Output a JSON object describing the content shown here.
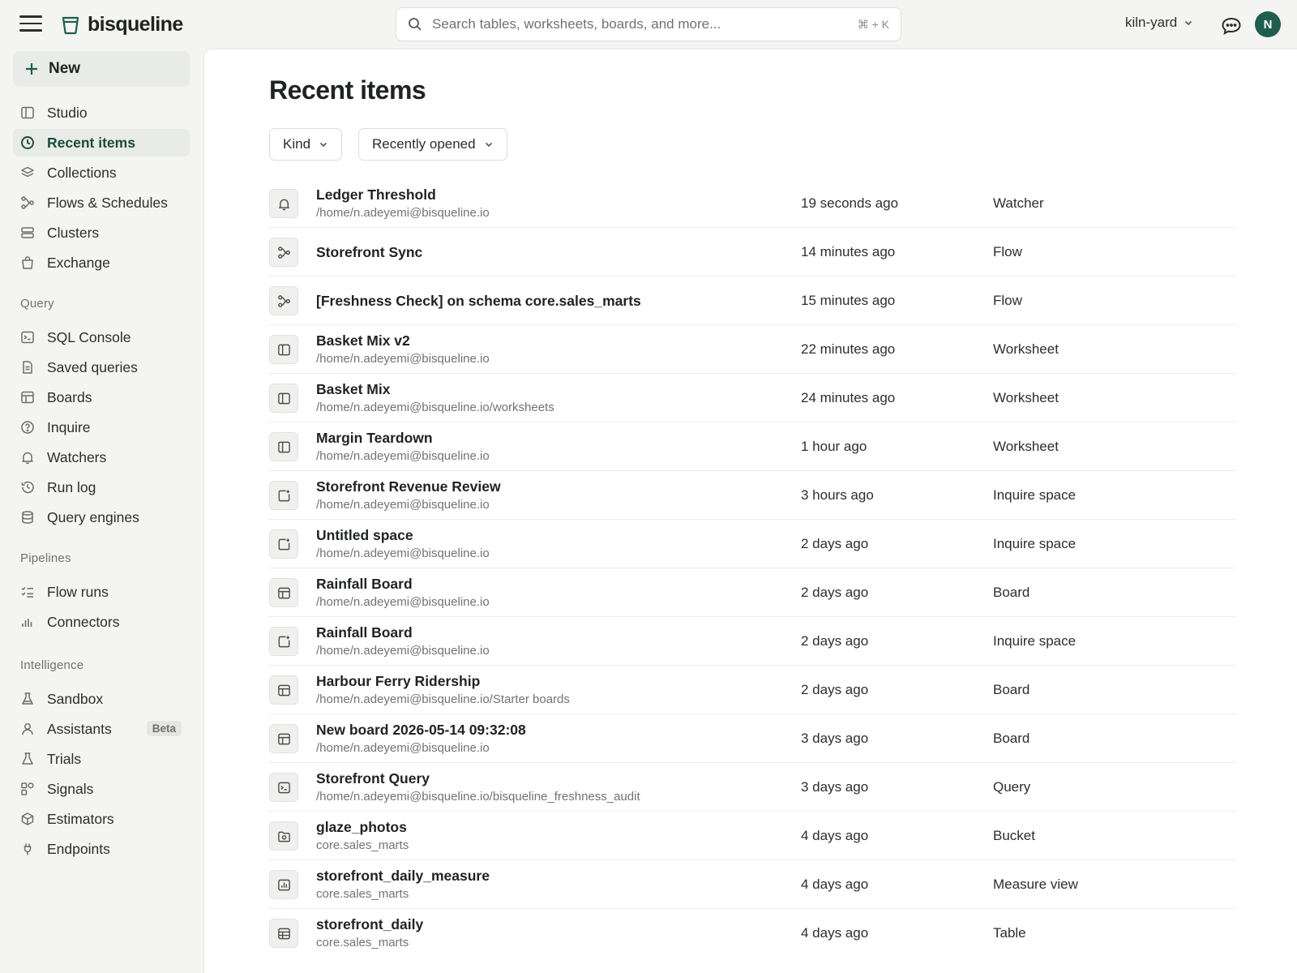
{
  "app": {
    "name": "bisqueline",
    "logo_icon": "bucket-logo-icon"
  },
  "search": {
    "placeholder": "Search tables, worksheets, boards, and more...",
    "shortcut": "⌘ + K"
  },
  "workspace": {
    "name": "kiln-yard"
  },
  "user": {
    "initial": "N",
    "avatar_color": "#1f5e4e"
  },
  "sidebar": {
    "new_label": "New",
    "main_items": [
      {
        "label": "Studio",
        "icon": "panel-icon"
      },
      {
        "label": "Recent items",
        "icon": "clock-icon",
        "active": true
      },
      {
        "label": "Collections",
        "icon": "layers-icon"
      },
      {
        "label": "Flows & Schedules",
        "icon": "flow-icon"
      },
      {
        "label": "Clusters",
        "icon": "server-icon"
      },
      {
        "label": "Exchange",
        "icon": "bag-icon"
      }
    ],
    "query_section": "Query",
    "query_items": [
      {
        "label": "SQL Console",
        "icon": "terminal-icon"
      },
      {
        "label": "Saved queries",
        "icon": "file-icon"
      },
      {
        "label": "Boards",
        "icon": "board-icon"
      },
      {
        "label": "Inquire",
        "icon": "question-icon"
      },
      {
        "label": "Watchers",
        "icon": "bell-icon"
      },
      {
        "label": "Run log",
        "icon": "history-icon"
      },
      {
        "label": "Query engines",
        "icon": "database-icon"
      }
    ],
    "pipelines_section": "Pipelines",
    "pipelines_items": [
      {
        "label": "Flow runs",
        "icon": "checklist-icon"
      },
      {
        "label": "Connectors",
        "icon": "bars-icon"
      }
    ],
    "intelligence_section": "Intelligence",
    "intelligence_items": [
      {
        "label": "Sandbox",
        "icon": "flask-icon"
      },
      {
        "label": "Assistants",
        "icon": "person-icon",
        "badge": "Beta"
      },
      {
        "label": "Trials",
        "icon": "beaker-icon"
      },
      {
        "label": "Signals",
        "icon": "shapes-icon"
      },
      {
        "label": "Estimators",
        "icon": "cube-icon"
      },
      {
        "label": "Endpoints",
        "icon": "plug-icon"
      }
    ]
  },
  "main": {
    "title": "Recent items",
    "filters": {
      "kind": "Kind",
      "sort": "Recently opened"
    },
    "items": [
      {
        "name": "Ledger Threshold",
        "path": "/home/n.adeyemi@bisqueline.io",
        "time": "19 seconds ago",
        "kind": "Watcher",
        "icon": "bell-icon"
      },
      {
        "name": "Storefront Sync",
        "path": "",
        "time": "14 minutes ago",
        "kind": "Flow",
        "icon": "flow-icon"
      },
      {
        "name": "[Freshness Check] on schema core.sales_marts",
        "path": "",
        "time": "15 minutes ago",
        "kind": "Flow",
        "icon": "flow-icon"
      },
      {
        "name": "Basket Mix v2",
        "path": "/home/n.adeyemi@bisqueline.io",
        "time": "22 minutes ago",
        "kind": "Worksheet",
        "icon": "worksheet-icon"
      },
      {
        "name": "Basket Mix",
        "path": "/home/n.adeyemi@bisqueline.io/worksheets",
        "time": "24 minutes ago",
        "kind": "Worksheet",
        "icon": "worksheet-icon"
      },
      {
        "name": "Margin Teardown",
        "path": "/home/n.adeyemi@bisqueline.io",
        "time": "1 hour ago",
        "kind": "Worksheet",
        "icon": "worksheet-icon"
      },
      {
        "name": "Storefront Revenue Review",
        "path": "/home/n.adeyemi@bisqueline.io",
        "time": "3 hours ago",
        "kind": "Inquire space",
        "icon": "inquire-space-icon"
      },
      {
        "name": "Untitled space",
        "path": "/home/n.adeyemi@bisqueline.io",
        "time": "2 days ago",
        "kind": "Inquire space",
        "icon": "inquire-space-icon"
      },
      {
        "name": "Rainfall Board",
        "path": "/home/n.adeyemi@bisqueline.io",
        "time": "2 days ago",
        "kind": "Board",
        "icon": "board-icon"
      },
      {
        "name": "Rainfall Board",
        "path": "/home/n.adeyemi@bisqueline.io",
        "time": "2 days ago",
        "kind": "Inquire space",
        "icon": "inquire-space-icon"
      },
      {
        "name": "Harbour Ferry Ridership",
        "path": "/home/n.adeyemi@bisqueline.io/Starter boards",
        "time": "2 days ago",
        "kind": "Board",
        "icon": "board-icon"
      },
      {
        "name": "New board 2026-05-14 09:32:08",
        "path": "/home/n.adeyemi@bisqueline.io",
        "time": "3 days ago",
        "kind": "Board",
        "icon": "board-icon"
      },
      {
        "name": "Storefront Query",
        "path": "/home/n.adeyemi@bisqueline.io/bisqueline_freshness_audit",
        "time": "3 days ago",
        "kind": "Query",
        "icon": "terminal-icon"
      },
      {
        "name": "glaze_photos",
        "path": "core.sales_marts",
        "time": "4 days ago",
        "kind": "Bucket",
        "icon": "folder-image-icon"
      },
      {
        "name": "storefront_daily_measure",
        "path": "core.sales_marts",
        "time": "4 days ago",
        "kind": "Measure view",
        "icon": "measure-icon"
      },
      {
        "name": "storefront_daily",
        "path": "core.sales_marts",
        "time": "4 days ago",
        "kind": "Table",
        "icon": "table-icon"
      }
    ]
  }
}
